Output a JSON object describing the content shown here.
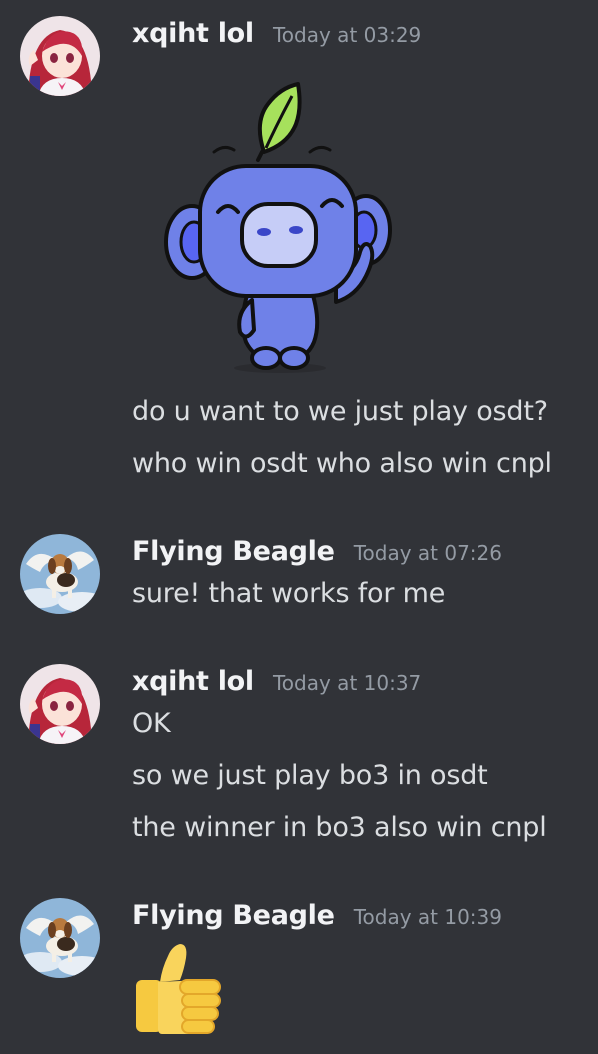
{
  "messages": [
    {
      "username": "xqiht lol",
      "timestamp": "Today at 03:29",
      "sticker": "wumpus-waving-sticker",
      "lines": [
        "do u want to we just play osdt?",
        "who win osdt who also win cnpl"
      ]
    },
    {
      "username": "Flying Beagle",
      "timestamp": "Today at 07:26",
      "lines": [
        "sure! that works for me"
      ]
    },
    {
      "username": "xqiht lol",
      "timestamp": "Today at 10:37",
      "lines": [
        "OK",
        "so we just play bo3 in osdt",
        "the winner in bo3 also win cnpl"
      ]
    },
    {
      "username": "Flying Beagle",
      "timestamp": "Today at 10:39",
      "emoji": "thumbs-up-icon"
    }
  ],
  "colors": {
    "background": "#313338",
    "username": "#f2f3f5",
    "timestamp": "#949ba4",
    "text": "#dbdee1"
  }
}
